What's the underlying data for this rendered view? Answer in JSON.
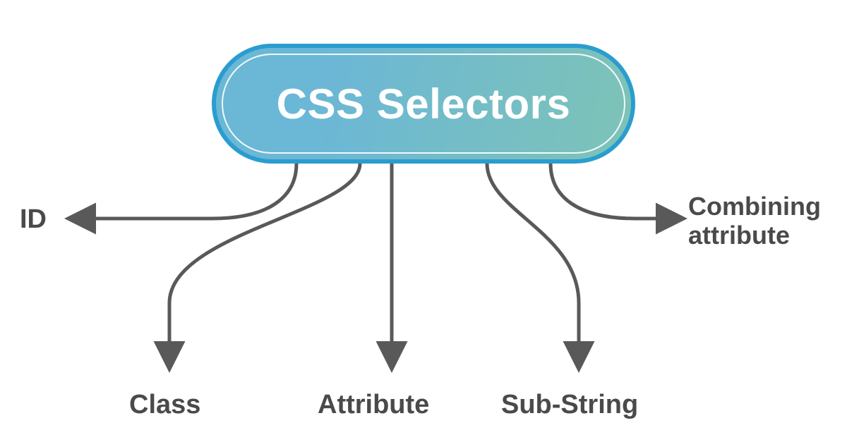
{
  "diagram": {
    "root_label": "CSS Selectors",
    "branches": {
      "id": "ID",
      "class": "Class",
      "attribute": "Attribute",
      "substring": "Sub-String",
      "combining": "Combining\nattribute"
    },
    "colors": {
      "arrow": "#595959",
      "pill_border": "#2a9dcf",
      "pill_grad_start": "#6bb7d6",
      "pill_grad_end": "#7dc3b7",
      "text": "#4a4a4a",
      "root_text": "#ffffff"
    }
  }
}
